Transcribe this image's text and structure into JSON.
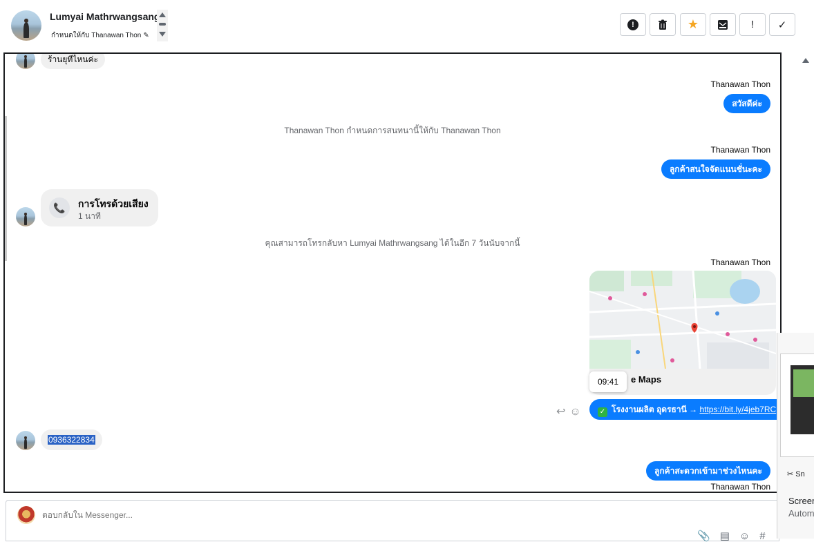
{
  "header": {
    "contact_name": "Lumyai Mathrwangsang",
    "assigned_to": "กำหนดให้กับ Thanawan Thon",
    "toolbar_icons": [
      "report-icon",
      "trash-icon",
      "star-icon",
      "archive-mail-icon",
      "exclamation-icon",
      "check-icon"
    ],
    "toolbar_glyphs": {
      "report": "!",
      "trash": "🗑",
      "star": "★",
      "archive": "🖂",
      "flag": "!",
      "done": "✓"
    }
  },
  "conversation": {
    "first_incoming": "ร้านยุทีไหนค่ะ",
    "sender_name": "Thanawan Thon",
    "greeting": "สวัสดีค่ะ",
    "system_assign": "Thanawan Thon กำหนดการสนทนานี้ให้กับ Thanawan Thon",
    "outgoing_interest": "ลูกค้าสนใจจัดแนนชั่นะคะ",
    "call": {
      "title": "การโทรด้วยเสียง",
      "duration": "1 นาที",
      "glyph": "📞"
    },
    "system_callback": "คุณสามารถโทรกลับหา Lumyai Mathrwangsang ได้ในอีก 7 วันนับจากนี้",
    "map_caption": "e Maps",
    "timestamp_tooltip": "09:41",
    "link_message": {
      "check_glyph": "✓",
      "text": "โรงงานผลิต อุดรธานี → ",
      "url": "https://bit.ly/4jeb7RC"
    },
    "action_glyphs": {
      "reply": "↩",
      "react": "☺"
    },
    "phone_number": "0936322834",
    "outgoing_convenient": "ลูกค้าสะดวกเข้ามาช่วงไหนคะ"
  },
  "composer": {
    "placeholder": "ตอบกลับใน Messenger...",
    "icons": [
      "attach-icon",
      "template-icon",
      "emoji-icon",
      "hashtag-icon"
    ],
    "icon_glyphs": {
      "attach": "📎",
      "template": "▤",
      "emoji": "☺",
      "hashtag": "#"
    }
  },
  "overlay": {
    "snip_label": "Sn",
    "title": "Screer",
    "subtitle": "Autom"
  },
  "colors": {
    "messenger_blue": "#0a7cff",
    "incoming_bubble": "#f0f0f0",
    "star": "#f5a623"
  }
}
